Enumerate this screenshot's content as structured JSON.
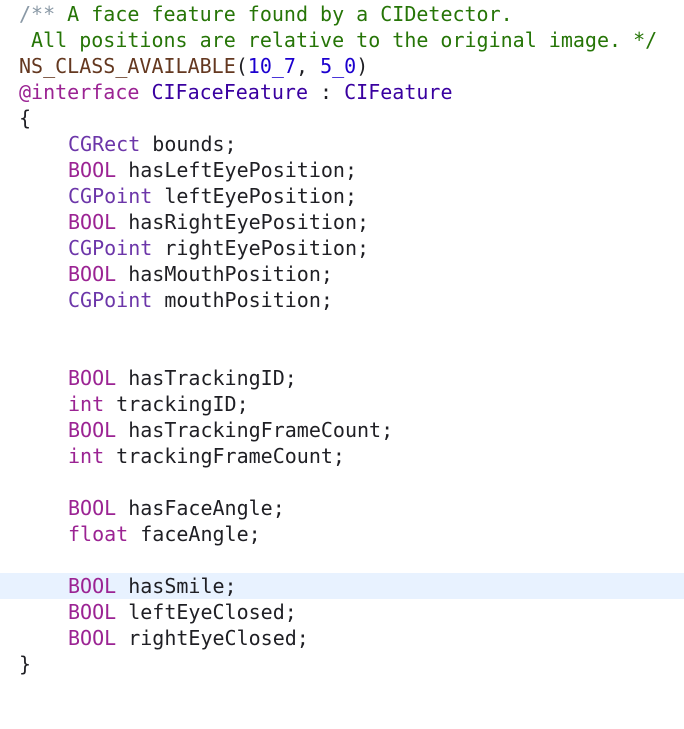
{
  "editor": {
    "comment": {
      "open": "/**",
      "line1_text": " A face feature found by a CIDetector.",
      "line2_text": " All positions are relative to the original image. ",
      "close": "*/"
    },
    "macro_line": {
      "macro": "NS_CLASS_AVAILABLE",
      "open_paren": "(",
      "arg1": "10_7",
      "sep": ", ",
      "arg2": "5_0",
      "close_paren": ")"
    },
    "interface_line": {
      "keyword": "@interface",
      "class_name": "CIFaceFeature",
      "colon": " : ",
      "superclass": "CIFeature"
    },
    "open_brace": "{",
    "close_brace": "}",
    "ivars": {
      "bounds": {
        "type": "CGRect",
        "name": " bounds;"
      },
      "has_left_eye": {
        "type": "BOOL",
        "name": " hasLeftEyePosition;"
      },
      "left_eye": {
        "type": "CGPoint",
        "name": " leftEyePosition;"
      },
      "has_right_eye": {
        "type": "BOOL",
        "name": " hasRightEyePosition;"
      },
      "right_eye": {
        "type": "CGPoint",
        "name": " rightEyePosition;"
      },
      "has_mouth": {
        "type": "BOOL",
        "name": " hasMouthPosition;"
      },
      "mouth": {
        "type": "CGPoint",
        "name": " mouthPosition;"
      },
      "has_tracking_id": {
        "type": "BOOL",
        "name": " hasTrackingID;"
      },
      "tracking_id": {
        "type": "int",
        "name": " trackingID;"
      },
      "has_tracking_frame_count": {
        "type": "BOOL",
        "name": " hasTrackingFrameCount;"
      },
      "tracking_frame_count": {
        "type": "int",
        "name": " trackingFrameCount;"
      },
      "has_face_angle": {
        "type": "BOOL",
        "name": " hasFaceAngle;"
      },
      "face_angle": {
        "type": "float",
        "name": " faceAngle;"
      },
      "has_smile": {
        "type": "BOOL",
        "name": " hasSmile;"
      },
      "left_eye_closed": {
        "type": "BOOL",
        "name": " leftEyeClosed;"
      },
      "right_eye_closed": {
        "type": "BOOL",
        "name": " rightEyeClosed;"
      }
    }
  }
}
